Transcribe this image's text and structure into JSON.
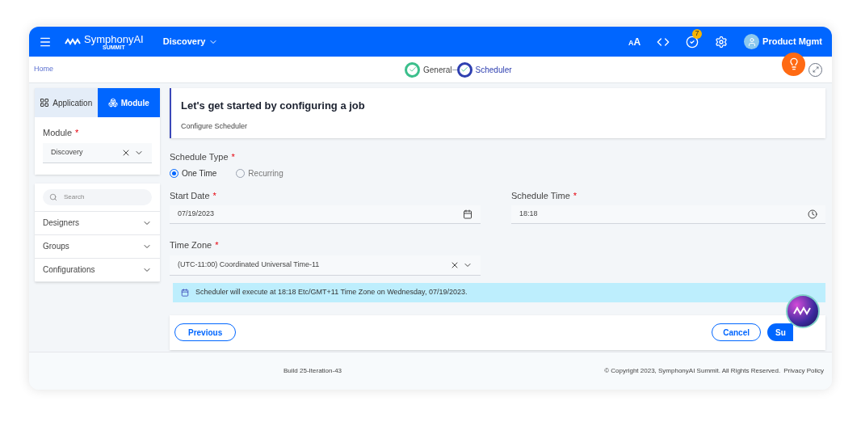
{
  "header": {
    "brand": "SymphonyAI",
    "brand_sub": "SUMMIT",
    "module": "Discovery",
    "font_small": "A",
    "font_large": "A",
    "task_count": "7",
    "user": "Product Mgmt"
  },
  "breadcrumb": "Home",
  "steps": [
    {
      "label": "General",
      "selected": false
    },
    {
      "label": "Scheduler",
      "selected": true
    }
  ],
  "side_tabs": [
    {
      "label": "Application",
      "selected": false
    },
    {
      "label": "Module",
      "selected": true
    }
  ],
  "module_field": {
    "label": "Module",
    "required_mark": "*",
    "value": "Discovery"
  },
  "search": {
    "placeholder": "Search"
  },
  "nav": [
    {
      "label": "Designers",
      "expanded": false
    },
    {
      "label": "Groups",
      "expanded": false
    },
    {
      "label": "Configurations",
      "expanded": false
    }
  ],
  "intro": {
    "title": "Let's get started by configuring a job",
    "subtitle": "Configure Scheduler"
  },
  "schedule_type": {
    "label": "Schedule Type",
    "required_mark": "*",
    "options": [
      {
        "label": "One Time",
        "selected": true
      },
      {
        "label": "Recurring",
        "selected": false
      }
    ]
  },
  "start_date": {
    "label": "Start Date",
    "required_mark": "*",
    "value": "07/19/2023"
  },
  "schedule_time": {
    "label": "Schedule Time",
    "required_mark": "*",
    "value": "18:18"
  },
  "time_zone": {
    "label": "Time Zone",
    "required_mark": "*",
    "value": "(UTC-11:00) Coordinated Universal Time-11"
  },
  "info": "Scheduler will execute at 18:18 Etc/GMT+11 Time Zone on Wednesday, 07/19/2023.",
  "buttons": {
    "previous": "Previous",
    "cancel": "Cancel",
    "submit": "Su"
  },
  "footer": {
    "build": "Build 25-Iteration-43",
    "copyright": "© Copyright 2023, SymphonyAI Summit. All Rights Reserved.",
    "privacy": "Privacy Policy"
  }
}
